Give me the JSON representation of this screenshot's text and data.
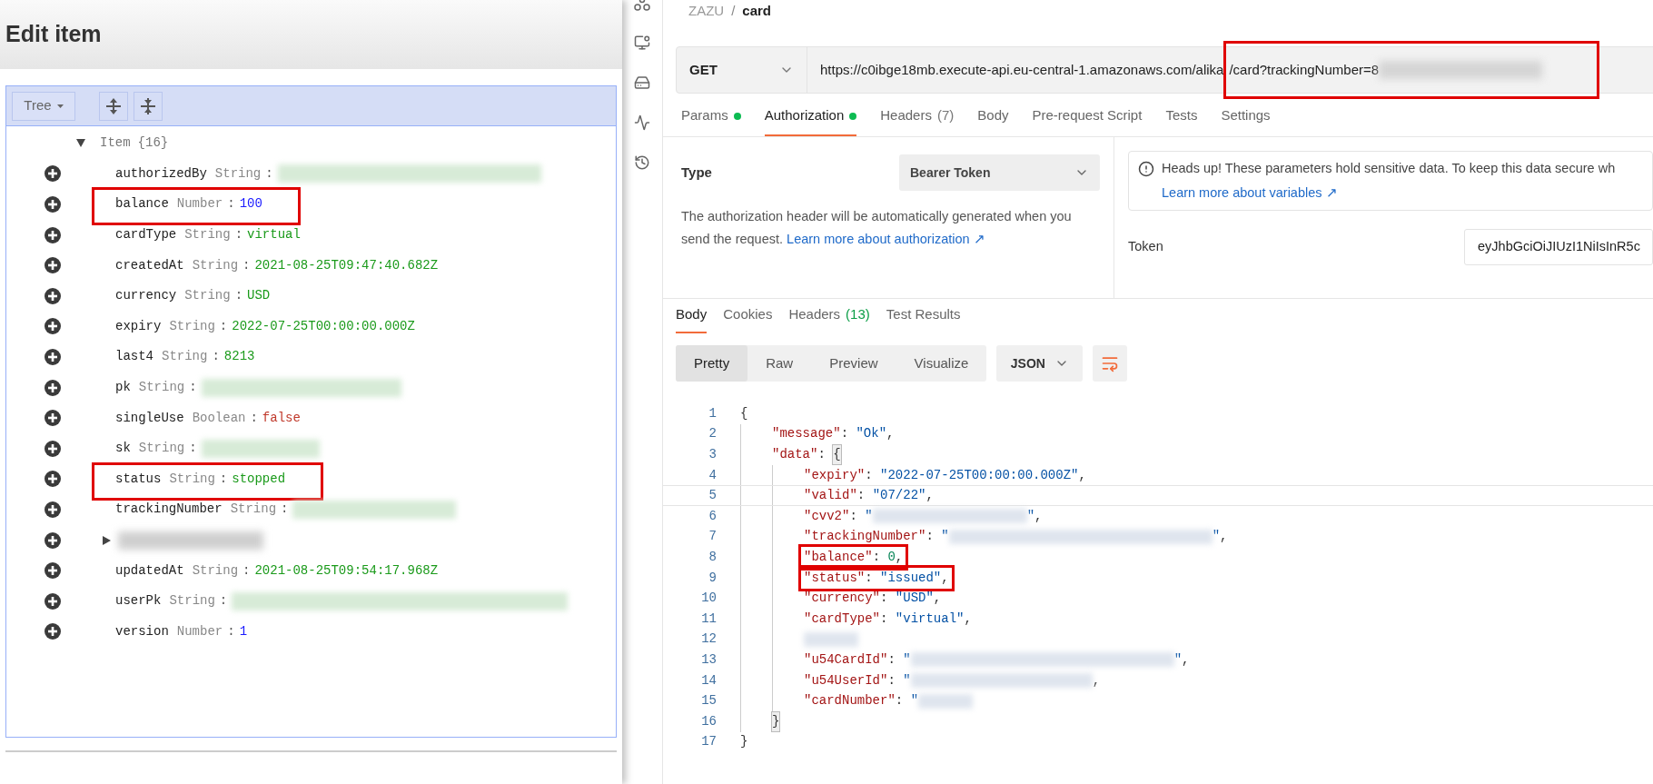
{
  "editor": {
    "title": "Edit item",
    "mode": "Tree",
    "root": {
      "key": "Item",
      "count": "{16}",
      "expanded": true,
      "children": [
        {
          "kind": "redacted_field",
          "key": "authorizedBy",
          "type": "String",
          "separator": ":",
          "highlighted": false
        },
        {
          "kind": "number_field",
          "key": "balance",
          "type": "Number",
          "separator": ":",
          "value": "100",
          "highlighted": true
        },
        {
          "kind": "string_field",
          "key": "cardType",
          "type": "String",
          "separator": ":",
          "value": "virtual",
          "highlighted": false
        },
        {
          "kind": "string_field",
          "key": "createdAt",
          "type": "String",
          "separator": ":",
          "value": "2021-08-25T09:47:40.682Z",
          "highlighted": false
        },
        {
          "kind": "string_field",
          "key": "currency",
          "type": "String",
          "separator": ":",
          "value": "USD",
          "highlighted": false
        },
        {
          "kind": "string_field",
          "key": "expiry",
          "type": "String",
          "separator": ":",
          "value": "2022-07-25T00:00:00.000Z",
          "highlighted": false
        },
        {
          "kind": "string_field",
          "key": "last4",
          "type": "String",
          "separator": ":",
          "value": "8213",
          "highlighted": false
        },
        {
          "kind": "redacted_field",
          "key": "pk",
          "type": "String",
          "separator": ":",
          "highlighted": false
        },
        {
          "kind": "boolean_field",
          "key": "singleUse",
          "type": "Boolean",
          "separator": ":",
          "value": "false",
          "highlighted": false
        },
        {
          "kind": "redacted_field",
          "key": "sk",
          "type": "String",
          "separator": ":",
          "highlighted": false
        },
        {
          "kind": "string_field",
          "key": "status",
          "type": "String",
          "separator": ":",
          "value": "stopped",
          "highlighted": true
        },
        {
          "kind": "redacted_field",
          "key": "trackingNumber",
          "type": "String",
          "separator": ":",
          "highlighted": false
        },
        {
          "kind": "redacted_node",
          "expanded": false
        },
        {
          "kind": "string_field",
          "key": "updatedAt",
          "type": "String",
          "separator": ":",
          "value": "2021-08-25T09:54:17.968Z",
          "highlighted": false
        },
        {
          "kind": "redacted_field",
          "key": "userPk",
          "type": "String",
          "separator": ":",
          "highlighted": false
        },
        {
          "kind": "number_field",
          "key": "version",
          "type": "Number",
          "separator": ":",
          "value": "1",
          "highlighted": false
        }
      ]
    }
  },
  "client": {
    "breadcrumb": [
      "ZAZU",
      "card"
    ],
    "breadcrumb_separator": "/",
    "method": "GET",
    "url_segments": [
      {
        "text": "https://c0ibge18mb.execute-api.eu-central-1.amazonaws.com/alika",
        "highlighted": false
      },
      {
        "text": "/card?trackingNumber=8",
        "highlighted": true
      }
    ],
    "url_redacted_tail": true,
    "request_tabs": [
      {
        "label": "Params",
        "dot": true,
        "selected": false
      },
      {
        "label": "Authorization",
        "dot": true,
        "selected": true
      },
      {
        "label": "Headers",
        "count": "(7)",
        "dot": false,
        "selected": false
      },
      {
        "label": "Body",
        "dot": false,
        "selected": false
      },
      {
        "label": "Pre-request Script",
        "dot": false,
        "selected": false
      },
      {
        "label": "Tests",
        "dot": false,
        "selected": false
      },
      {
        "label": "Settings",
        "dot": false,
        "selected": false
      }
    ],
    "auth": {
      "type_label": "Type",
      "type_value": "Bearer Token",
      "description": "The authorization header will be automatically generated when you send the request.",
      "description_link": "Learn more about authorization ↗",
      "notice": "Heads up! These parameters hold sensitive data. To keep this data secure wh",
      "notice_link": "Learn more about variables ↗",
      "token_label": "Token",
      "token_value": "eyJhbGciOiJIUzI1NiIsInR5c"
    },
    "response_tabs": [
      {
        "label": "Body",
        "selected": true
      },
      {
        "label": "Cookies",
        "selected": false
      },
      {
        "label": "Headers",
        "count": "(13)",
        "selected": false
      },
      {
        "label": "Test Results",
        "selected": false
      }
    ],
    "view_modes": [
      {
        "label": "Pretty",
        "selected": true
      },
      {
        "label": "Raw",
        "selected": false
      },
      {
        "label": "Preview",
        "selected": false
      },
      {
        "label": "Visualize",
        "selected": false
      }
    ],
    "format": "JSON",
    "code": [
      {
        "number": "1",
        "tokens": [
          {
            "kind": "punct",
            "text": "{"
          }
        ],
        "children": [
          {
            "number": "2",
            "tokens": [
              {
                "kind": "key",
                "text": "\"message\""
              },
              {
                "kind": "punct",
                "text": ": "
              },
              {
                "kind": "string",
                "text": "\"Ok\""
              },
              {
                "kind": "punct",
                "text": ","
              }
            ]
          },
          {
            "number": "3",
            "tokens": [
              {
                "kind": "key",
                "text": "\"data\""
              },
              {
                "kind": "punct",
                "text": ": "
              },
              {
                "kind": "bracket",
                "text": "{"
              }
            ],
            "children": [
              {
                "number": "4",
                "tokens": [
                  {
                    "kind": "key",
                    "text": "\"expiry\""
                  },
                  {
                    "kind": "punct",
                    "text": ": "
                  },
                  {
                    "kind": "string",
                    "text": "\"2022-07-25T00:00:00.000Z\""
                  },
                  {
                    "kind": "punct",
                    "text": ","
                  }
                ]
              },
              {
                "number": "5",
                "current": true,
                "tokens": [
                  {
                    "kind": "key",
                    "text": "\"valid\""
                  },
                  {
                    "kind": "punct",
                    "text": ": "
                  },
                  {
                    "kind": "string",
                    "text": "\"07/22\""
                  },
                  {
                    "kind": "punct",
                    "text": ","
                  }
                ]
              },
              {
                "number": "6",
                "tokens": [
                  {
                    "kind": "key",
                    "text": "\"cvv2\""
                  },
                  {
                    "kind": "punct",
                    "text": ": "
                  },
                  {
                    "kind": "string",
                    "text": "\""
                  },
                  {
                    "kind": "redacted"
                  },
                  {
                    "kind": "string",
                    "text": "\""
                  },
                  {
                    "kind": "punct",
                    "text": ","
                  }
                ]
              },
              {
                "number": "7",
                "tokens": [
                  {
                    "kind": "key",
                    "text": "\"trackingNumber\""
                  },
                  {
                    "kind": "punct",
                    "text": ": "
                  },
                  {
                    "kind": "string",
                    "text": "\""
                  },
                  {
                    "kind": "redacted"
                  },
                  {
                    "kind": "string",
                    "text": "\""
                  },
                  {
                    "kind": "punct",
                    "text": ","
                  }
                ]
              },
              {
                "number": "8",
                "highlighted": true,
                "tokens": [
                  {
                    "kind": "key",
                    "text": "\"balance\""
                  },
                  {
                    "kind": "punct",
                    "text": ": "
                  },
                  {
                    "kind": "number",
                    "text": "0"
                  },
                  {
                    "kind": "punct",
                    "text": ","
                  }
                ]
              },
              {
                "number": "9",
                "highlighted": true,
                "tokens": [
                  {
                    "kind": "key",
                    "text": "\"status\""
                  },
                  {
                    "kind": "punct",
                    "text": ": "
                  },
                  {
                    "kind": "string",
                    "text": "\"issued\""
                  },
                  {
                    "kind": "punct",
                    "text": ","
                  }
                ]
              },
              {
                "number": "10",
                "tokens": [
                  {
                    "kind": "key",
                    "text": "\"currency\""
                  },
                  {
                    "kind": "punct",
                    "text": ": "
                  },
                  {
                    "kind": "string",
                    "text": "\"USD\""
                  },
                  {
                    "kind": "punct",
                    "text": ","
                  }
                ]
              },
              {
                "number": "11",
                "tokens": [
                  {
                    "kind": "key",
                    "text": "\"cardType\""
                  },
                  {
                    "kind": "punct",
                    "text": ": "
                  },
                  {
                    "kind": "string",
                    "text": "\"virtual\""
                  },
                  {
                    "kind": "punct",
                    "text": ","
                  }
                ]
              },
              {
                "number": "12",
                "tokens": [
                  {
                    "kind": "redacted"
                  }
                ]
              },
              {
                "number": "13",
                "tokens": [
                  {
                    "kind": "key",
                    "text": "\"u54CardId\""
                  },
                  {
                    "kind": "punct",
                    "text": ": "
                  },
                  {
                    "kind": "string",
                    "text": "\""
                  },
                  {
                    "kind": "redacted"
                  },
                  {
                    "kind": "string",
                    "text": "\""
                  },
                  {
                    "kind": "punct",
                    "text": ","
                  }
                ]
              },
              {
                "number": "14",
                "tokens": [
                  {
                    "kind": "key",
                    "text": "\"u54UserId\""
                  },
                  {
                    "kind": "punct",
                    "text": ": "
                  },
                  {
                    "kind": "string",
                    "text": "\""
                  },
                  {
                    "kind": "redacted"
                  },
                  {
                    "kind": "punct",
                    "text": ","
                  }
                ]
              },
              {
                "number": "15",
                "tokens": [
                  {
                    "kind": "key",
                    "text": "\"cardNumber\""
                  },
                  {
                    "kind": "punct",
                    "text": ": "
                  },
                  {
                    "kind": "string",
                    "text": "\""
                  },
                  {
                    "kind": "redacted"
                  }
                ]
              }
            ]
          },
          {
            "number": "16",
            "tokens": [
              {
                "kind": "bracket",
                "text": "}"
              }
            ]
          }
        ]
      },
      {
        "number": "17",
        "tokens": [
          {
            "kind": "punct",
            "text": "}"
          }
        ]
      }
    ]
  }
}
